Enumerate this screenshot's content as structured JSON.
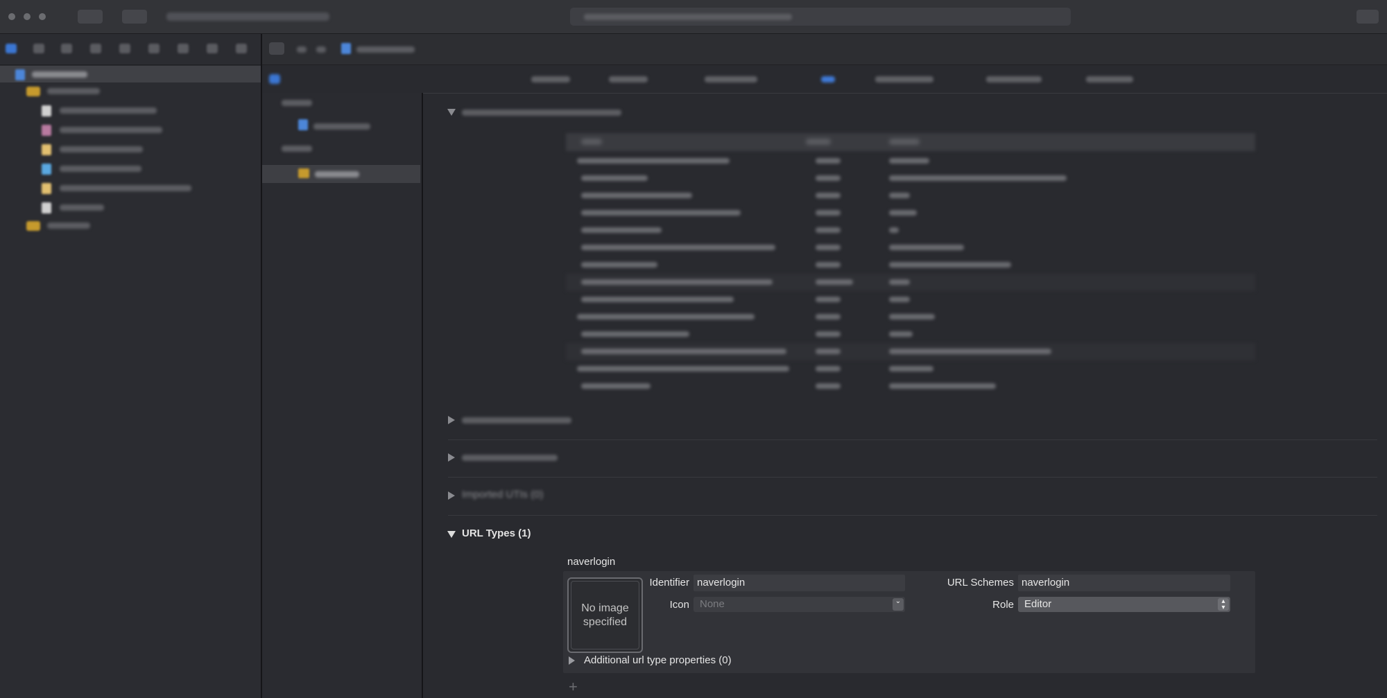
{
  "sections": {
    "imported_utis": "Imported UTIs (0)",
    "url_types": "URL Types (1)"
  },
  "url_type": {
    "name": "naverlogin",
    "image_well": "No image specified",
    "identifier_label": "Identifier",
    "identifier_value": "naverlogin",
    "icon_label": "Icon",
    "icon_placeholder": "None",
    "url_schemes_label": "URL Schemes",
    "url_schemes_value": "naverlogin",
    "role_label": "Role",
    "role_value": "Editor",
    "additional_props": "Additional url type properties (0)"
  },
  "add_symbol": "+",
  "colors": {
    "background": "#292a2f",
    "panel": "#323338",
    "accent": "#3b76d2",
    "folder": "#c69a2d"
  }
}
